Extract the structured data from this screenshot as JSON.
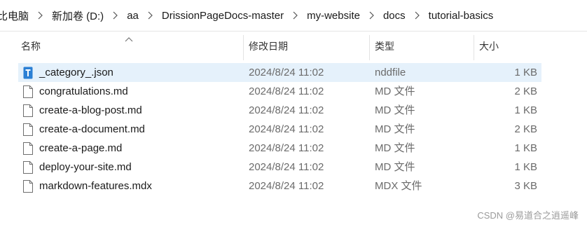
{
  "breadcrumb": {
    "items": [
      "比电脑",
      "新加卷 (D:)",
      "aa",
      "DrissionPageDocs-master",
      "my-website",
      "docs",
      "tutorial-basics"
    ]
  },
  "columns": {
    "name": "名称",
    "modified": "修改日期",
    "type": "类型",
    "size": "大小"
  },
  "files": [
    {
      "name": "_category_.json",
      "modified": "2024/8/24 11:02",
      "type": "nddfile",
      "size": "1 KB",
      "icon": "nddfile-icon",
      "selected": true
    },
    {
      "name": "congratulations.md",
      "modified": "2024/8/24 11:02",
      "type": "MD 文件",
      "size": "2 KB",
      "icon": "file-icon",
      "selected": false
    },
    {
      "name": "create-a-blog-post.md",
      "modified": "2024/8/24 11:02",
      "type": "MD 文件",
      "size": "1 KB",
      "icon": "file-icon",
      "selected": false
    },
    {
      "name": "create-a-document.md",
      "modified": "2024/8/24 11:02",
      "type": "MD 文件",
      "size": "2 KB",
      "icon": "file-icon",
      "selected": false
    },
    {
      "name": "create-a-page.md",
      "modified": "2024/8/24 11:02",
      "type": "MD 文件",
      "size": "1 KB",
      "icon": "file-icon",
      "selected": false
    },
    {
      "name": "deploy-your-site.md",
      "modified": "2024/8/24 11:02",
      "type": "MD 文件",
      "size": "1 KB",
      "icon": "file-icon",
      "selected": false
    },
    {
      "name": "markdown-features.mdx",
      "modified": "2024/8/24 11:02",
      "type": "MDX 文件",
      "size": "3 KB",
      "icon": "file-icon",
      "selected": false
    }
  ],
  "watermark": "CSDN @易道合之逍遥峰",
  "colors": {
    "selected_row": "#e5f1fb",
    "nddfile_icon": "#2b7fd4"
  }
}
